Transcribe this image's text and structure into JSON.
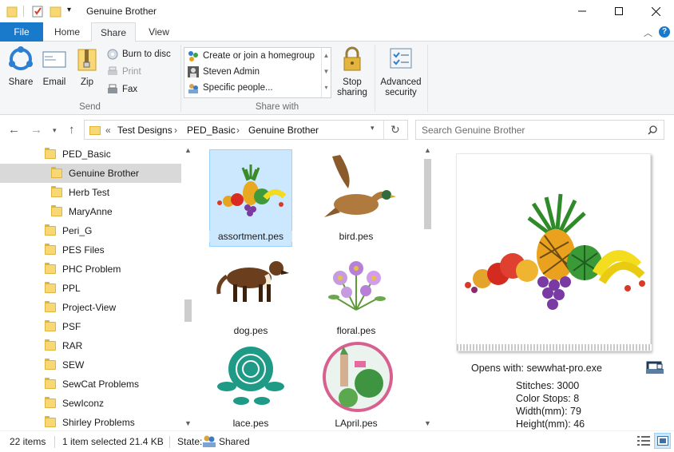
{
  "window": {
    "title": "Genuine Brother"
  },
  "ribbon_tabs": [
    {
      "label": "File"
    },
    {
      "label": "Home"
    },
    {
      "label": "Share"
    },
    {
      "label": "View"
    }
  ],
  "ribbon": {
    "send": {
      "group_label": "Send",
      "share": "Share",
      "email": "Email",
      "zip": "Zip",
      "burn": "Burn to disc",
      "print": "Print",
      "fax": "Fax"
    },
    "share_with": {
      "group_label": "Share with",
      "items": [
        "Create or join a homegroup",
        "Steven Admin",
        "Specific people..."
      ],
      "stop_sharing": "Stop sharing",
      "advanced_security": "Advanced security"
    }
  },
  "address": {
    "overflow": "«",
    "breadcrumbs": [
      "Test Designs",
      "PED_Basic",
      "Genuine Brother"
    ],
    "search_placeholder": "Search Genuine Brother"
  },
  "nav_tree": [
    {
      "label": "PED_Basic",
      "indent": 0
    },
    {
      "label": "Genuine Brother",
      "indent": 1,
      "selected": true
    },
    {
      "label": "Herb Test",
      "indent": 1
    },
    {
      "label": "MaryAnne",
      "indent": 1
    },
    {
      "label": "Peri_G",
      "indent": 0
    },
    {
      "label": "PES Files",
      "indent": 0
    },
    {
      "label": "PHC Problem",
      "indent": 0
    },
    {
      "label": "PPL",
      "indent": 0
    },
    {
      "label": "Project-View",
      "indent": 0
    },
    {
      "label": "PSF",
      "indent": 0
    },
    {
      "label": "RAR",
      "indent": 0
    },
    {
      "label": "SEW",
      "indent": 0
    },
    {
      "label": "SewCat Problems",
      "indent": 0
    },
    {
      "label": "SewIconz",
      "indent": 0
    },
    {
      "label": "Shirley Problems",
      "indent": 0
    }
  ],
  "files": [
    {
      "name": "assortment.pes",
      "icon": "fruit-assortment-thumbnail",
      "selected": true
    },
    {
      "name": "bird.pes",
      "icon": "duck-thumbnail"
    },
    {
      "name": "dog.pes",
      "icon": "dog-thumbnail"
    },
    {
      "name": "floral.pes",
      "icon": "flowers-thumbnail"
    },
    {
      "name": "lace.pes",
      "icon": "lace-rose-thumbnail"
    },
    {
      "name": "LApril.pes",
      "icon": "landscape-circle-thumbnail"
    }
  ],
  "preview": {
    "opens_with": "Opens with: sewwhat-pro.exe",
    "stats": [
      "Stitches: 3000",
      "Color Stops: 8",
      "Width(mm): 79",
      "Height(mm): 46"
    ]
  },
  "status": {
    "count": "22 items",
    "selection": "1 item selected  21.4 KB",
    "state_label": "State:",
    "state_value": "Shared"
  },
  "colors": {
    "accent": "#1979ca",
    "selection": "#cce8ff",
    "folder": "#f8d775"
  }
}
